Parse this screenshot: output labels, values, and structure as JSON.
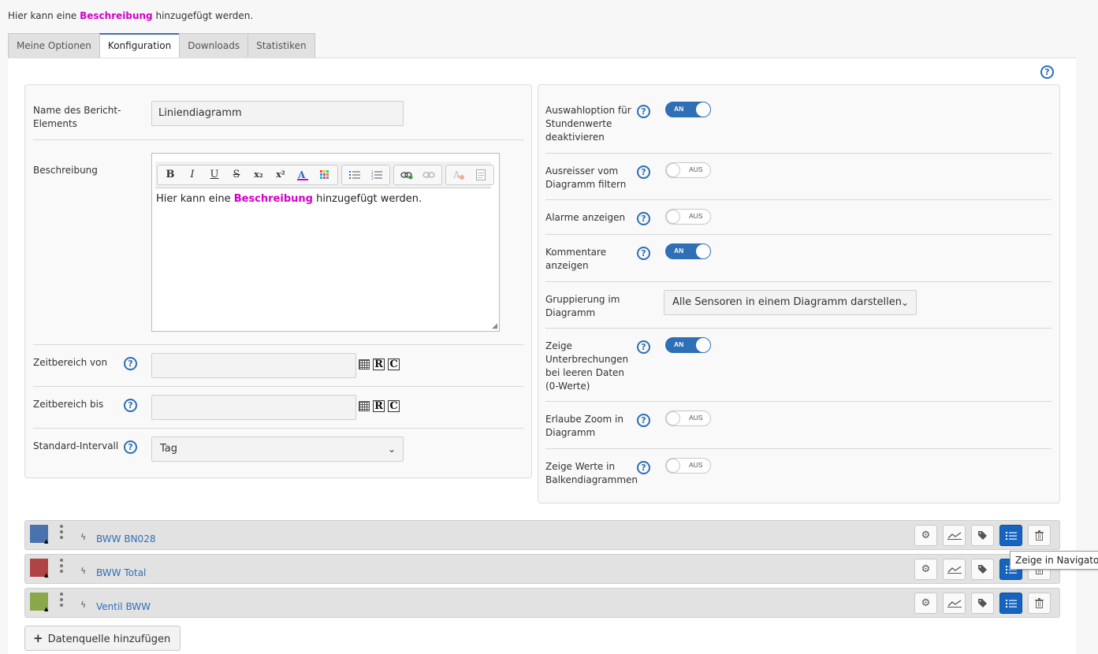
{
  "intro": {
    "before": "Hier kann eine ",
    "highlight": "Beschreibung",
    "after": " hinzugefügt werden."
  },
  "tabs": [
    {
      "label": "Meine Optionen",
      "active": false
    },
    {
      "label": "Konfiguration",
      "active": true
    },
    {
      "label": "Downloads",
      "active": false
    },
    {
      "label": "Statistiken",
      "active": false
    }
  ],
  "help_glyph": "?",
  "left": {
    "name_label": "Name des Bericht-Elements",
    "name_value": "Liniendiagramm",
    "desc_label": "Beschreibung",
    "toolbar": {
      "bold": "B",
      "italic": "I",
      "underline": "U",
      "strike": "S",
      "sub": "x₂",
      "sup": "x²",
      "textcolor_icon": "text-color-icon",
      "bgcolor_icon": "bg-color-icon",
      "bullets_icon": "bulleted-list-icon",
      "numbers_icon": "numbered-list-icon",
      "link_icon": "link-icon",
      "unlink_icon": "unlink-icon",
      "removeformat_icon": "remove-format-icon",
      "source_icon": "source-icon"
    },
    "editor_text": {
      "before": "Hier kann eine ",
      "highlight": "Beschreibung",
      "after": " hinzugefügt werden."
    },
    "from_label": "Zeitbereich von",
    "to_label": "Zeitbereich bis",
    "date_r": "R",
    "date_c": "C",
    "interval_label": "Standard-Intervall",
    "interval_value": "Tag"
  },
  "right": {
    "options": [
      {
        "label": "Auswahloption für Stundenwerte deaktivieren",
        "state": "AN",
        "on": true
      },
      {
        "label": "Ausreisser vom Diagramm filtern",
        "state": "AUS",
        "on": false
      },
      {
        "label": "Alarme anzeigen",
        "state": "AUS",
        "on": false
      },
      {
        "label": "Kommentare anzeigen",
        "state": "AN",
        "on": true
      },
      {
        "label": "Gruppierung im Diagramm",
        "select": "Alle Sensoren in einem Diagramm darstellen"
      },
      {
        "label": "Zeige Unterbrechungen bei leeren Daten (0-Werte)",
        "state": "AN",
        "on": true
      },
      {
        "label": "Erlaube Zoom in Diagramm",
        "state": "AUS",
        "on": false
      },
      {
        "label": "Zeige Werte in Balkendiagrammen",
        "state": "AUS",
        "on": false
      }
    ]
  },
  "datasources": [
    {
      "name": "BWW BN028",
      "color": "#4a72ac"
    },
    {
      "name": "BWW Total",
      "color": "#b04343"
    },
    {
      "name": "Ventil BWW",
      "color": "#8aa84a"
    }
  ],
  "tooltip": "Zeige in Navigator.",
  "add_datasource": "Datenquelle hinzufügen"
}
